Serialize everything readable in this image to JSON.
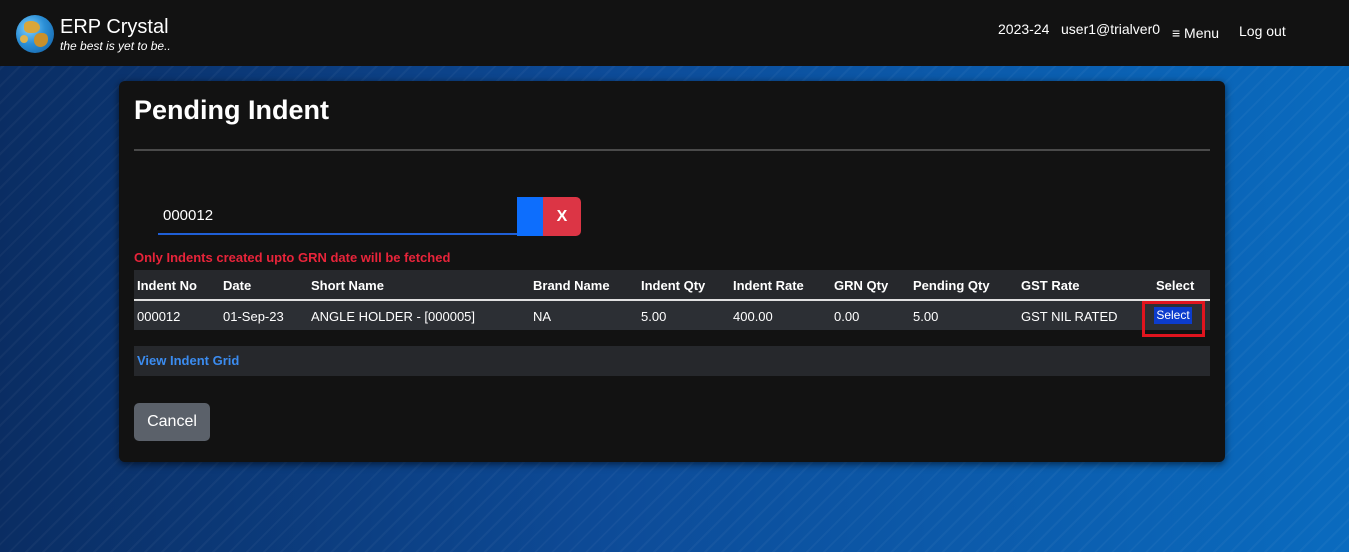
{
  "header": {
    "app_title": "ERP Crystal",
    "tagline": "the best is yet to be..",
    "year": "2023-24",
    "user": "user1@trialver0",
    "menu_label": "≡ Menu",
    "logout_label": "Log out"
  },
  "page": {
    "title": "Pending Indent",
    "search_value": "000012",
    "clear_label": "X",
    "warning": "Only Indents created upto GRN date will be fetched",
    "view_grid_label": "View Indent Grid",
    "cancel_label": "Cancel"
  },
  "table": {
    "headers": [
      "Indent No",
      "Date",
      "Short Name",
      "Brand Name",
      "Indent Qty",
      "Indent Rate",
      "GRN Qty",
      "Pending Qty",
      "GST Rate",
      "Select"
    ],
    "rows": [
      {
        "indent_no": "000012",
        "date": "01-Sep-23",
        "short_name": "ANGLE HOLDER - [000005]",
        "brand_name": "NA",
        "indent_qty": "5.00",
        "indent_rate": "400.00",
        "grn_qty": "0.00",
        "pending_qty": "5.00",
        "gst_rate": "GST NIL RATED",
        "select_label": "Select"
      }
    ]
  },
  "colors": {
    "accent_blue": "#0d6efd",
    "danger_red": "#dc3545",
    "warning_text": "#e8243a",
    "highlight_box": "#e0141e"
  }
}
